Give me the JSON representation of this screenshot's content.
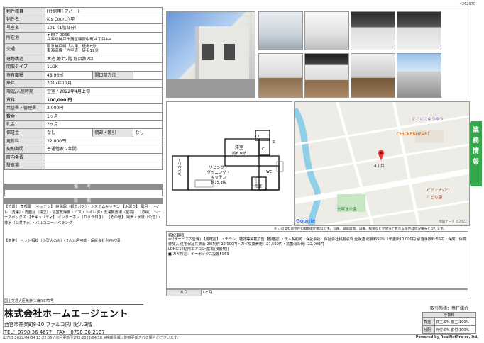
{
  "doc_id": "4262970",
  "spec": [
    {
      "k": "物件種目",
      "v": "[住居用] アパート"
    },
    {
      "k": "物件名",
      "v": "K's Court六甲"
    },
    {
      "k": "号室名",
      "v": "101（1階部分）"
    },
    {
      "k": "所在地",
      "v": "〒657-0066\n兵庫県神戸市灘区篠原中町４丁目4-4"
    },
    {
      "k": "交通",
      "v": "阪急神戸線「六甲」徒歩8分\n東海道線「六甲道」徒歩19分"
    },
    {
      "k": "建物構造",
      "v": "木造 地上2階 総戸数2戸"
    },
    {
      "k": "間取タイプ",
      "v": "1LDK"
    }
  ],
  "area": {
    "k": "専有面積",
    "v": "48.96㎡",
    "k2": "開口部方位",
    "v2": ""
  },
  "spec2": [
    {
      "k": "築年",
      "v": "2017年11月"
    },
    {
      "k": "現況/入居時期",
      "v": "空室 / 2022年4月上旬"
    }
  ],
  "rent": {
    "k": "賃料",
    "v": "100,000 円"
  },
  "spec3": [
    {
      "k": "共益費・管理費",
      "v": "2,000円"
    },
    {
      "k": "敷金",
      "v": "1ヶ月"
    },
    {
      "k": "礼金",
      "v": "2ヶ月"
    }
  ],
  "deposit": {
    "k": "保証金",
    "v": "なし",
    "k2": "償却・敷引",
    "v2": "なし"
  },
  "spec4": [
    {
      "k": "更新料",
      "v": "22,000円"
    },
    {
      "k": "契約期間",
      "v": "普通借家 2年間"
    },
    {
      "k": "町内会費",
      "v": ""
    },
    {
      "k": "駐車場",
      "v": ""
    }
  ],
  "remarks_title": "備　考",
  "facilities_title": "設　備",
  "facilities_text": "【位置】 角部屋 【キッチン】 給湯器（都市ガス）・システムキッチン 【水廻り】 風呂・トイレ（洗浄）・洗面台（独立）・浴室乾燥機・バス・トイレ別・洗濯機置場（室内） 【収納】 シューズボックス 【セキュリティ】 インターホン（カメラ付き） 【その他】 電気・水道（公営）・排水（公共下水）・バルコニー／ベランダ",
  "conditions_text": "【条件】 ペット相談（小型犬のみ）・2人入居可能・保証会社利用必須",
  "floorplan": {
    "ldk_label": "リビング・\nダイニング・\nキッチン\n約15.3帖",
    "western_label": "洋室\n約8.0帖",
    "balcony": "バルコニー",
    "cl": "CL",
    "bath": "浴室",
    "wc": "WC"
  },
  "map": {
    "label1": "CHICKENHEART",
    "label2": "にこにこゆうゆう",
    "label3": "4丁目",
    "label4": "光塚池公園",
    "label5": "ピザ・ナポリ",
    "label6": "こども園",
    "google": "Google",
    "credit": "地図データ ©2022"
  },
  "map_note": "※ この資料は物件の概略紹介資料です。写真、間取図面、設備、概要などが現況と異なる場合は現況優先となります。",
  "special_title": "特記事項",
  "special_text": "ad(サービス広告費) 【要確認】 ・チラシ、雑誌等掲載広告【要確認】・法人契約可・保証会社：保証会社利用必須 全保連 総賃料50％ 1年更新10,000円 引落手数料:55円・保険：保険要加入 住宅保証共済会 2年契約 20,000円・カギ交換費用：27,500円・抗菌消毒代：22,000円\nLDKに16帖用エアコン(基有(残置物))\n■ カギ所在：キーボックス設置5963",
  "ad": {
    "k": "ＡＤ",
    "v": "1ヶ月"
  },
  "company": {
    "license": "国土交通大臣免許(1)第9875号",
    "name": "株式会社ホームエージェント",
    "address": "西宮市神楽町8-10 ファルコ夙川ビル3階",
    "phone": "TEL：0798-36-4677　FAX：0798-36-2107"
  },
  "broker": {
    "title": "取引態様：専任媒介",
    "sub": "手数料",
    "r1k": "負担",
    "r1v": "貸主:0% 借主:100%",
    "r2k": "分配",
    "r2v": "元付:0% 客付:100%"
  },
  "green_tab": "業\n務\n情\n報",
  "footer_left": "出力日:2022/04/04 13:22:05 / 次回更新予定日:2022/04/18 ※掲載情報は随時更新される場合がございます。",
  "footer_right": "Powered by RealNetPro co.,ltd."
}
